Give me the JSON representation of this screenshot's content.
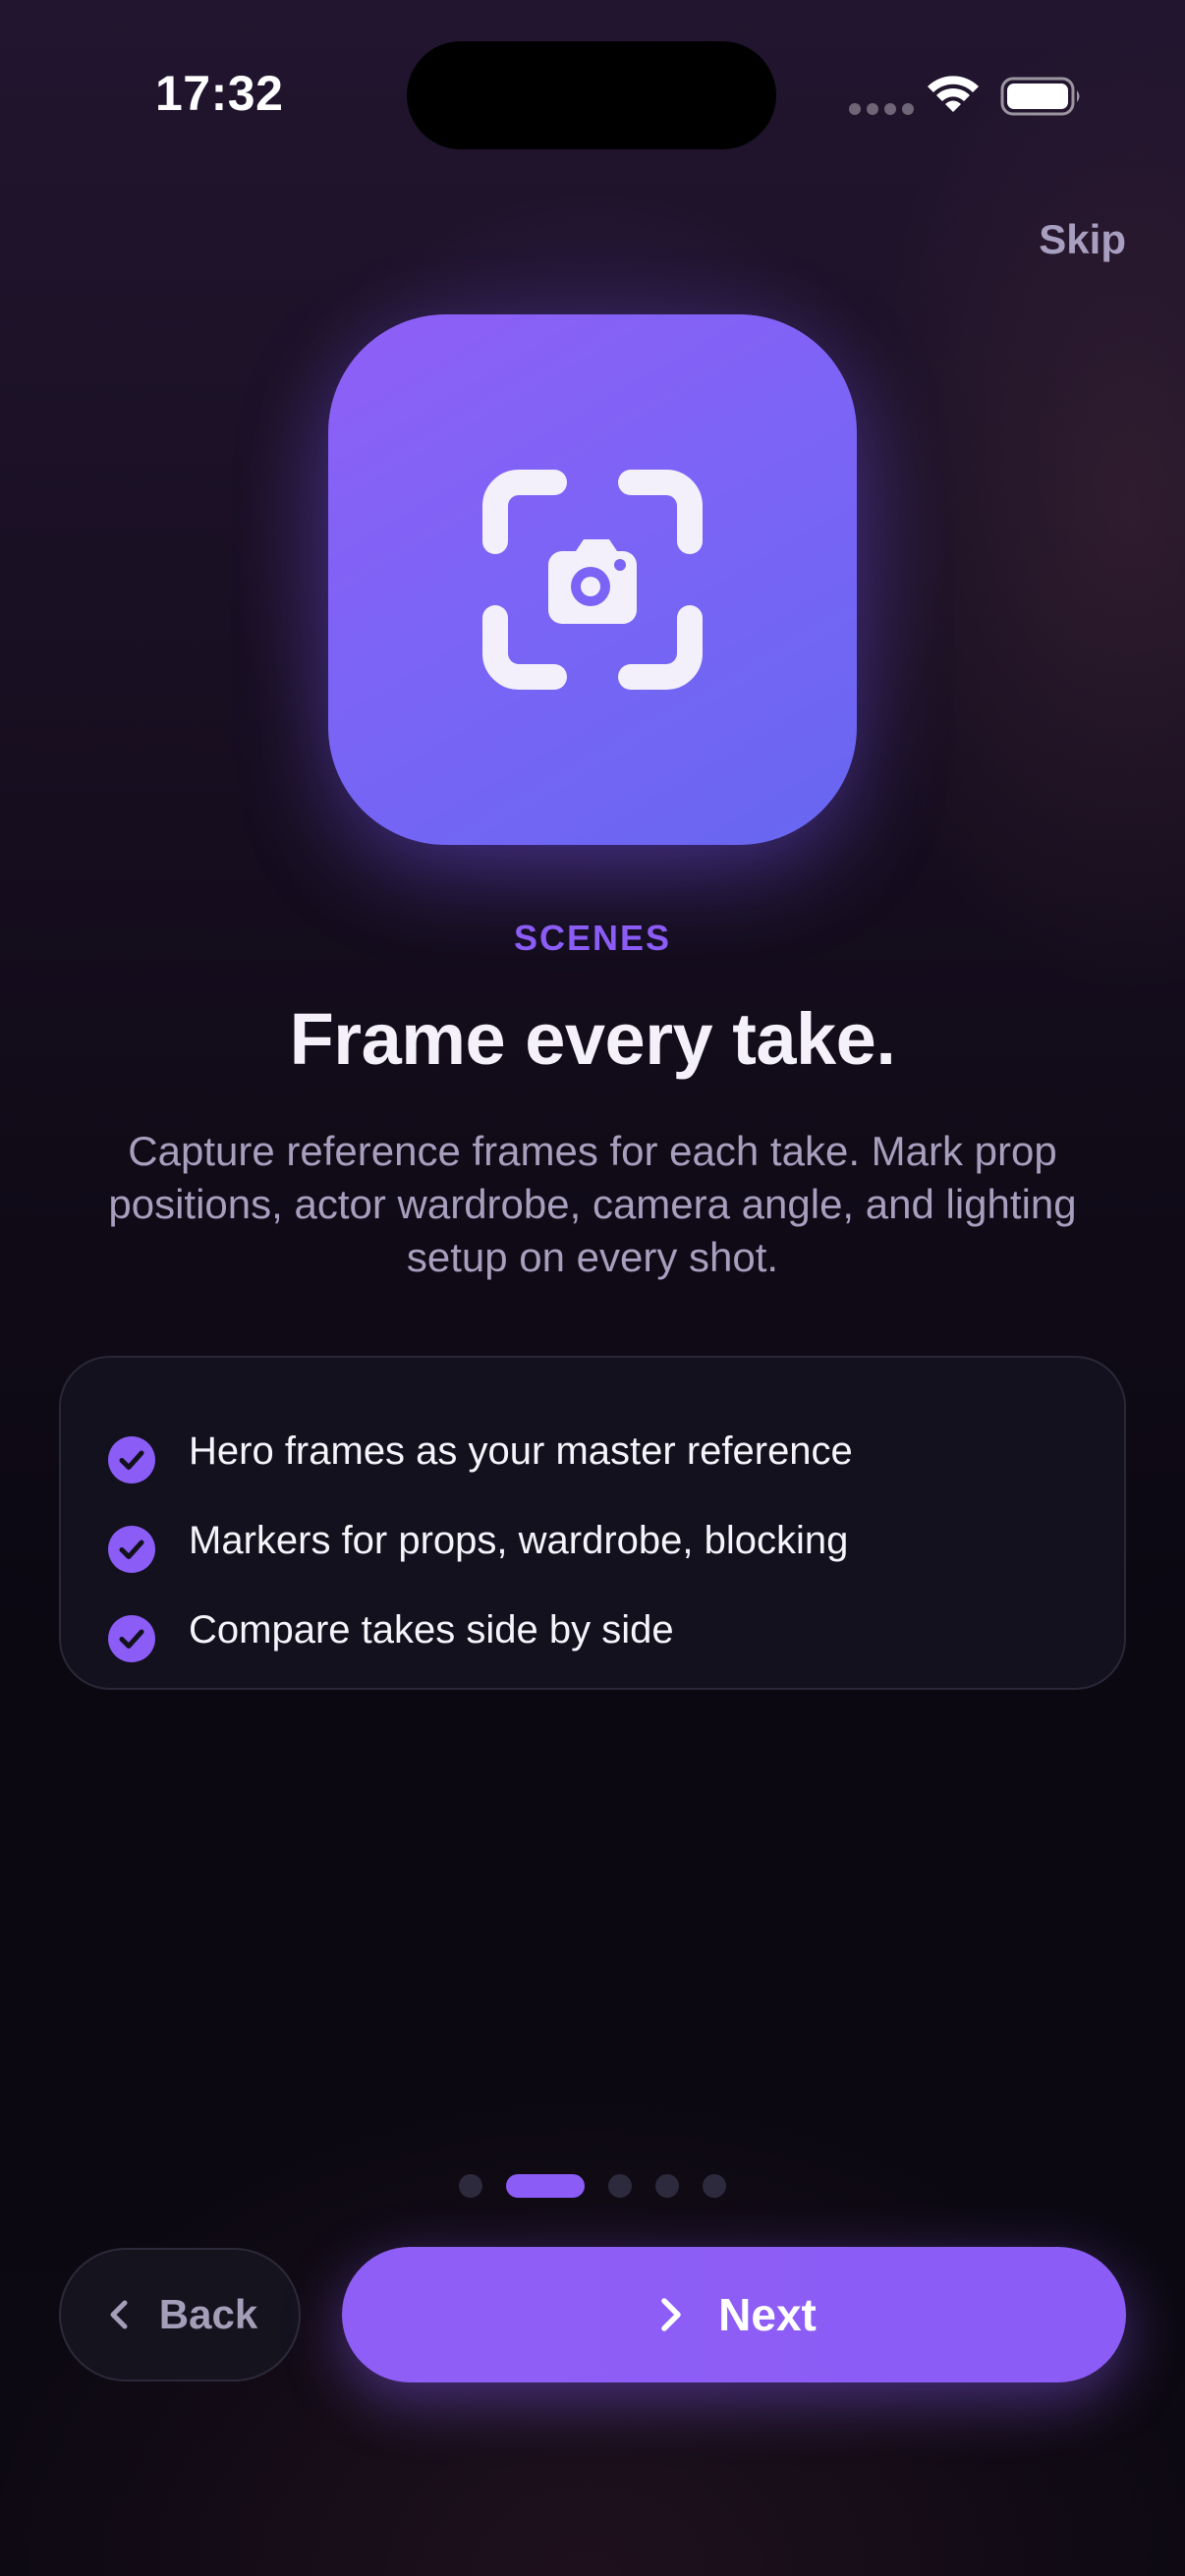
{
  "status_bar": {
    "time": "17:32"
  },
  "header": {
    "skip_label": "Skip"
  },
  "hero": {
    "icon": "camera-frame-icon",
    "gradient": [
      "#8f5ff7",
      "#6767f1"
    ]
  },
  "content": {
    "eyebrow": "SCENES",
    "title": "Frame every take.",
    "description": "Capture reference frames for each take. Mark prop positions, actor wardrobe, camera angle, and lighting setup on every shot."
  },
  "features": [
    {
      "icon": "check-circle-icon",
      "text": "Hero frames as your master reference"
    },
    {
      "icon": "check-circle-icon",
      "text": "Markers for props, wardrobe, blocking"
    },
    {
      "icon": "check-circle-icon",
      "text": "Compare takes side by side"
    }
  ],
  "pager": {
    "total": 5,
    "current": 2
  },
  "footer": {
    "back_label": "Back",
    "next_label": "Next"
  },
  "colors": {
    "accent": "#8b5cf6",
    "card_bg": "#12111d",
    "text_muted": "#a79fbd"
  }
}
